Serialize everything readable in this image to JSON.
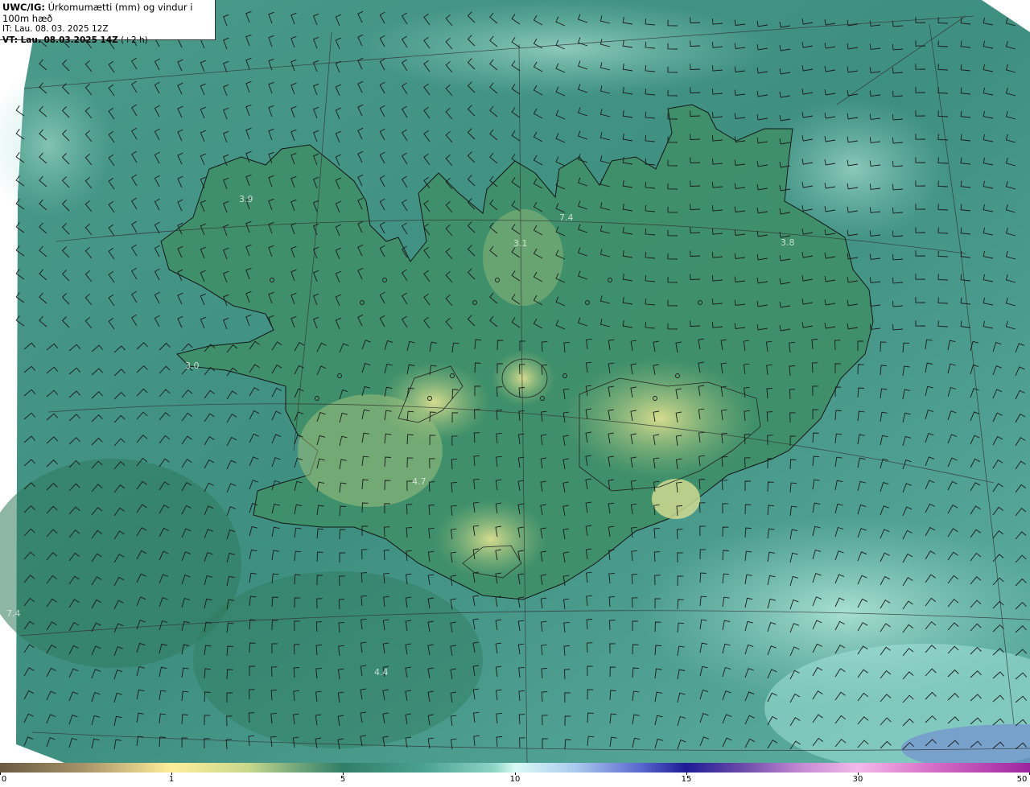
{
  "header": {
    "model": "UWC/IG:",
    "title": "Úrkomumætti (mm) og vindur i 100m hæð",
    "init_time": "IT: Lau. 08. 03. 2025 12Z",
    "valid_prefix": "VT: Lau. 08.03.2025 14Z",
    "valid_suffix": " (+2 h)"
  },
  "map_labels": [
    "3.9",
    "7.4",
    "3.1",
    "3.8",
    "3.0",
    "4.7",
    "7.4",
    "4.4"
  ],
  "colorbar": {
    "ticks": [
      "0",
      "1",
      "5",
      "10",
      "15",
      "30",
      "50"
    ]
  },
  "colors": {
    "sea": "#3d8c82",
    "land_low": "#3a8a64",
    "land_high": "#c9d88c",
    "light_precip": "#9ed8cc"
  }
}
